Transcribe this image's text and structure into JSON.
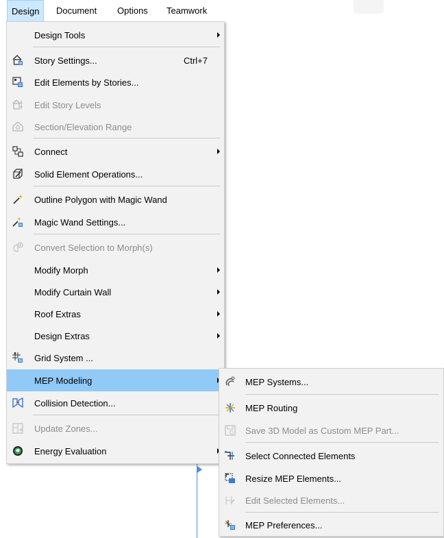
{
  "menubar": {
    "items": [
      {
        "label": "Design",
        "active": true
      },
      {
        "label": "Document"
      },
      {
        "label": "Options"
      },
      {
        "label": "Teamwork"
      }
    ]
  },
  "design_menu": {
    "items": [
      {
        "label": "Design Tools",
        "submenu": true,
        "icon": "none"
      },
      {
        "label": "Story Settings...",
        "shortcut": "Ctrl+7",
        "icon": "story-settings-icon"
      },
      {
        "label": "Edit Elements by Stories...",
        "icon": "edit-elements-by-stories-icon"
      },
      {
        "label": "Edit Story Levels",
        "disabled": true,
        "icon": "edit-story-levels-icon"
      },
      {
        "label": "Section/Elevation Range",
        "disabled": true,
        "icon": "section-elevation-range-icon"
      },
      {
        "label": "Connect",
        "submenu": true,
        "icon": "connect-icon"
      },
      {
        "label": "Solid Element Operations...",
        "icon": "solid-element-operations-icon"
      },
      {
        "label": "Outline Polygon with Magic Wand",
        "icon": "magic-wand-icon"
      },
      {
        "label": "Magic Wand Settings...",
        "icon": "magic-wand-settings-icon"
      },
      {
        "label": "Convert Selection to Morph(s)",
        "disabled": true,
        "icon": "convert-morph-icon"
      },
      {
        "label": "Modify Morph",
        "submenu": true,
        "icon": "none"
      },
      {
        "label": "Modify Curtain Wall",
        "submenu": true,
        "icon": "none"
      },
      {
        "label": "Roof Extras",
        "submenu": true,
        "icon": "none"
      },
      {
        "label": "Design Extras",
        "submenu": true,
        "icon": "none"
      },
      {
        "label": "Grid System ...",
        "icon": "grid-system-icon"
      },
      {
        "label": "MEP Modeling",
        "submenu": true,
        "highlighted": true,
        "icon": "none"
      },
      {
        "label": "Collision Detection...",
        "icon": "collision-detection-icon"
      },
      {
        "label": "Update Zones...",
        "disabled": true,
        "icon": "update-zones-icon"
      },
      {
        "label": "Energy Evaluation",
        "submenu": true,
        "icon": "energy-evaluation-icon"
      }
    ]
  },
  "mep_submenu": {
    "items": [
      {
        "label": "MEP Systems...",
        "icon": "mep-systems-icon"
      },
      {
        "label": "MEP Routing",
        "icon": "mep-routing-icon"
      },
      {
        "label": "Save 3D Model as Custom MEP Part...",
        "disabled": true,
        "icon": "save-3d-model-icon"
      },
      {
        "label": "Select Connected Elements",
        "icon": "select-connected-icon"
      },
      {
        "label": "Resize MEP Elements...",
        "icon": "resize-mep-icon"
      },
      {
        "label": "Edit Selected Elements...",
        "disabled": true,
        "icon": "edit-selected-elements-icon"
      },
      {
        "label": "MEP Preferences...",
        "icon": "mep-preferences-icon"
      }
    ]
  },
  "colors": {
    "menu_bg": "#f2f2f2",
    "highlight": "#91c9f7",
    "active_menubar": "#cce8ff",
    "disabled_text": "#8c8c8c"
  }
}
